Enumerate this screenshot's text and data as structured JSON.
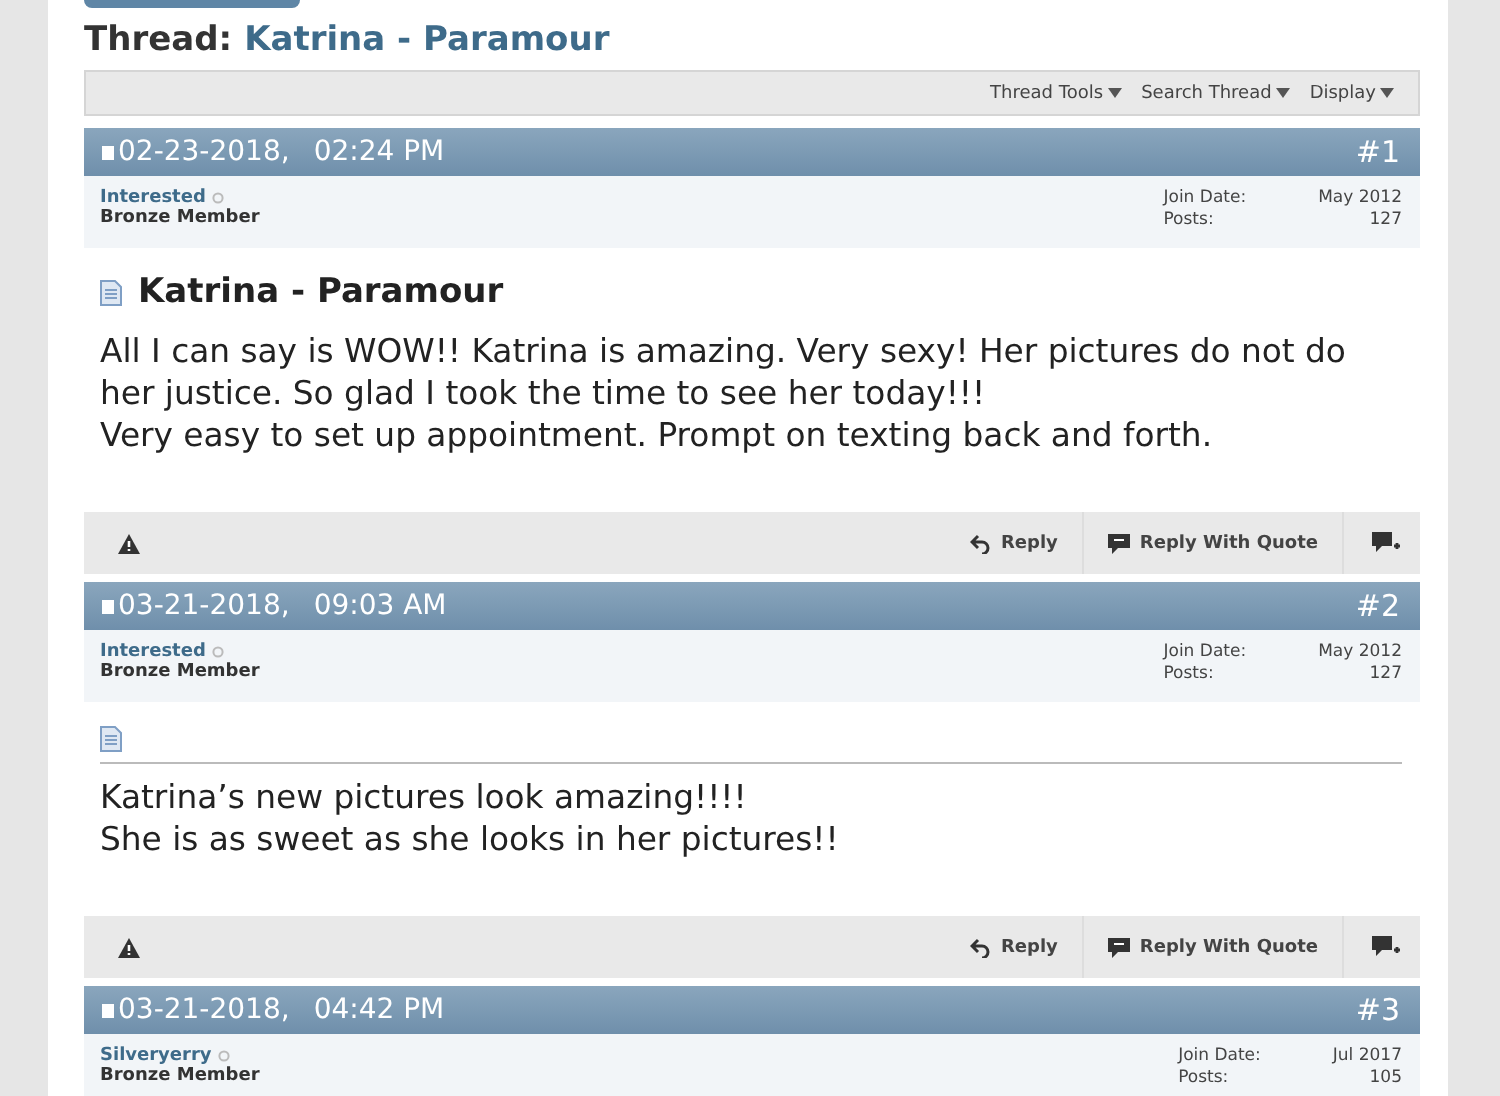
{
  "thread": {
    "label": "Thread:",
    "title": "Katrina - Paramour"
  },
  "toolbar": [
    "Thread Tools",
    "Search Thread",
    "Display"
  ],
  "posts": [
    {
      "date": "02-23-2018,",
      "time": "02:24 PM",
      "number": "#1",
      "user": "Interested",
      "rank": "Bronze Member",
      "join_label": "Join Date:",
      "join": "May 2012",
      "posts_label": "Posts:",
      "posts": "127",
      "title": "Katrina - Paramour",
      "lines": [
        "All I can say is WOW!! Katrina is amazing. Very sexy! Her pictures do not do her justice. So glad I took the time to see her today!!!",
        "Very easy to set up appointment. Prompt on texting back and forth."
      ],
      "actions": [
        "Reply",
        "Reply With Quote"
      ]
    },
    {
      "date": "03-21-2018,",
      "time": "09:03 AM",
      "number": "#2",
      "user": "Interested",
      "rank": "Bronze Member",
      "join_label": "Join Date:",
      "join": "May 2012",
      "posts_label": "Posts:",
      "posts": "127",
      "lines": [
        "Katrina’s new pictures look amazing!!!!",
        "She is as sweet as she looks in her pictures!!"
      ],
      "actions": [
        "Reply",
        "Reply With Quote"
      ]
    },
    {
      "date": "03-21-2018,",
      "time": "04:42 PM",
      "number": "#3",
      "user": "Silveryerry",
      "rank": "Bronze Member",
      "join_label": "Join Date:",
      "join": "Jul 2017",
      "posts_label": "Posts:",
      "posts": "105"
    }
  ]
}
